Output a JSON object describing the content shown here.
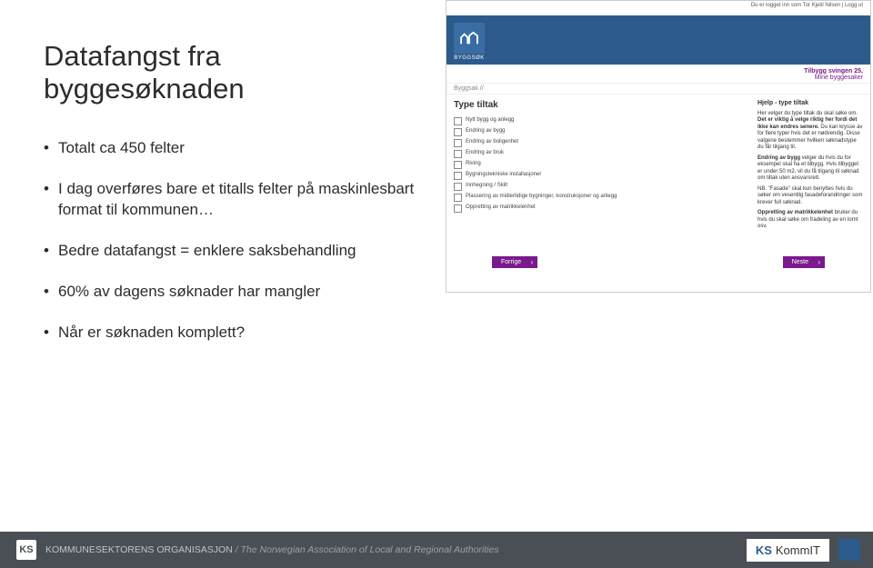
{
  "title": "Datafangst fra byggesøknaden",
  "bullets": [
    "Totalt ca 450 felter",
    "I dag overføres bare et titalls felter på maskinlesbart format til kommunen…",
    "Bedre datafangst = enklere saksbehandling",
    "60% av dagens søknader har mangler",
    "Når er søknaden komplett?"
  ],
  "shot": {
    "login": "Du er logget inn som Tor Kjetil Nilsen",
    "logout": "Logg ut",
    "brand": "BYGGSØK",
    "address": "Tilbygg svingen 25,",
    "mine": "Mine byggesaker",
    "crumb": "Byggsak //",
    "formTitle": "Type tiltak",
    "checks": [
      "Nytt bygg og anlegg",
      "Endring av bygg",
      "Endring av boligenhet",
      "Endring av bruk",
      "Riving",
      "Bygningstekniske installasjoner",
      "Innhegning / Skilt",
      "Plassering av midlertidige bygninger, konstruksjoner og anlegg",
      "Oppretting av matrikkelenhet"
    ],
    "help": {
      "title": "Hjelp - type tiltak",
      "p1a": "Her velger du type tiltak du skal søke om. ",
      "p1b": "Det er viktig å velge riktig her fordi det ikke kan endres senere.",
      "p1c": " Du kan krysse av for flere typer hvis det er nødvendig. Disse valgene bestemmer hvilken søknadstype du får tilgang til.",
      "p2a": "Endring av bygg",
      "p2b": " velger du hvis du for eksempel skal ha et tilbygg. Hvis tilbygget er under 50 m2, vil du få tilgang til søknad om tiltak uten ansvarsrett.",
      "p3a": "NB. \"Fasade\" skal kun benyttes hvis du søker om vesentlig fasadeforandringer som krever full søknad.",
      "p4a": "Oppretting av matrikkelenhet",
      "p4b": " bruker du hvis du skal søke om fradeling av en tomt osv."
    },
    "prev": "Forrige",
    "next": "Neste"
  },
  "footer": {
    "ks": "KS",
    "org": "KOMMUNESEKTORENS ORGANISASJON",
    "orgEn": " / The Norwegian Association of Local and Regional Authorities",
    "kommit_k": "KS",
    "kommit_t": " KommIT"
  }
}
